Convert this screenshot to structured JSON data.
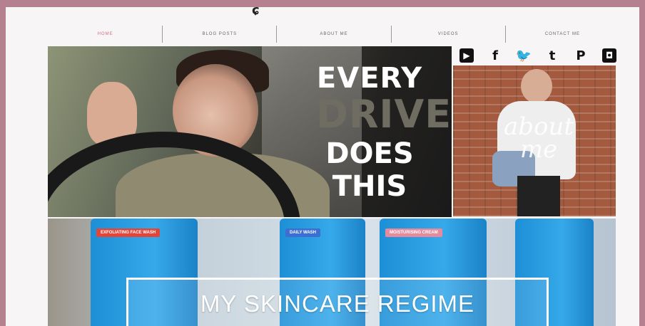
{
  "colors": {
    "frame": "#b5808f",
    "nav_active": "#d46a82",
    "page_bg": "#f7f5f5"
  },
  "header": {
    "mark": "ɕ"
  },
  "nav": [
    {
      "label": "HOME",
      "active": true
    },
    {
      "label": "BLOG POSTS",
      "active": false
    },
    {
      "label": "ABOUT ME",
      "active": false
    },
    {
      "label": "VIDEOS",
      "active": false
    },
    {
      "label": "CONTACT ME",
      "active": false
    }
  ],
  "hero": {
    "line1": "EVERY",
    "line2": "DRIVER",
    "line3": "DOES",
    "line4": "THIS"
  },
  "social": {
    "icons": [
      "youtube-icon",
      "facebook-icon",
      "twitter-icon",
      "tumblr-icon",
      "pinterest-icon",
      "instagram-icon"
    ],
    "glyphs": [
      "▶",
      "f",
      "🐦",
      "t",
      "P",
      "◘"
    ]
  },
  "side_photo": {
    "script": "about me"
  },
  "banner": {
    "title": "MY SKINCARE REGIME",
    "tags": [
      "EXFOLIATING FACE WASH",
      "DAILY WASH",
      "MOISTURISING CREAM"
    ]
  }
}
